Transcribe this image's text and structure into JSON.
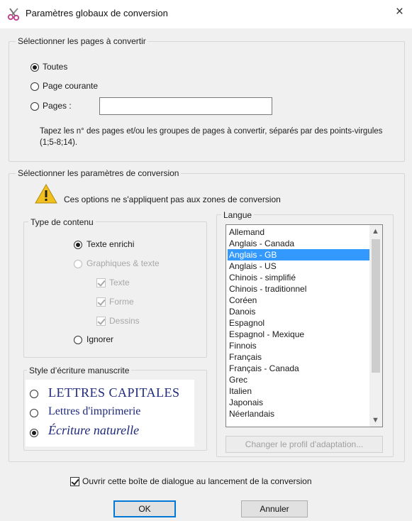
{
  "window": {
    "title": "Paramètres globaux de conversion",
    "close_glyph": "×",
    "app_icon": "scissors-icon"
  },
  "pages_group": {
    "legend": "Sélectionner les pages à convertir",
    "options": [
      {
        "label": "Toutes",
        "checked": true
      },
      {
        "label": "Page courante",
        "checked": false
      },
      {
        "label": "Pages :",
        "checked": false
      }
    ],
    "pages_input_value": "",
    "hint": "Tapez les n° des pages et/ou les groupes de pages à convertir, séparés par des points-virgules (1;5-8;14)."
  },
  "conversion_group": {
    "legend": "Sélectionner les paramètres de conversion",
    "warning": "Ces options ne s'appliquent pas aux zones de conversion",
    "warning_icon": "warning-icon"
  },
  "content_type": {
    "legend": "Type de contenu",
    "options": [
      {
        "label": "Texte enrichi",
        "checked": true,
        "disabled": false
      },
      {
        "label": "Graphiques & texte",
        "checked": false,
        "disabled": true
      }
    ],
    "sub_options": [
      {
        "label": "Texte",
        "checked": true
      },
      {
        "label": "Forme",
        "checked": true
      },
      {
        "label": "Dessins",
        "checked": true
      }
    ],
    "ignore_label": "Ignorer"
  },
  "handwriting": {
    "legend": "Style d’écriture manuscrite",
    "options": [
      {
        "label": "LETTRES CAPITALES",
        "checked": false
      },
      {
        "label": "Lettres d'imprimerie",
        "checked": false
      },
      {
        "label": "Écriture naturelle",
        "checked": true
      }
    ]
  },
  "language": {
    "legend": "Langue",
    "items": [
      "Allemand",
      "Anglais - Canada",
      "Anglais - GB",
      "Anglais - US",
      "Chinois - simplifié",
      "Chinois - traditionnel",
      "Coréen",
      "Danois",
      "Espagnol",
      "Espagnol - Mexique",
      "Finnois",
      "Français",
      "Français - Canada",
      "Grec",
      "Italien",
      "Japonais",
      "Néerlandais"
    ],
    "selected": "Anglais - GB",
    "change_profile_button": "Changer le profil d'adaptation..."
  },
  "footer": {
    "open_dialog_checkbox": "Ouvrir cette boîte de dialogue au lancement de la conversion",
    "open_dialog_checked": true,
    "ok": "OK",
    "cancel": "Annuler"
  }
}
